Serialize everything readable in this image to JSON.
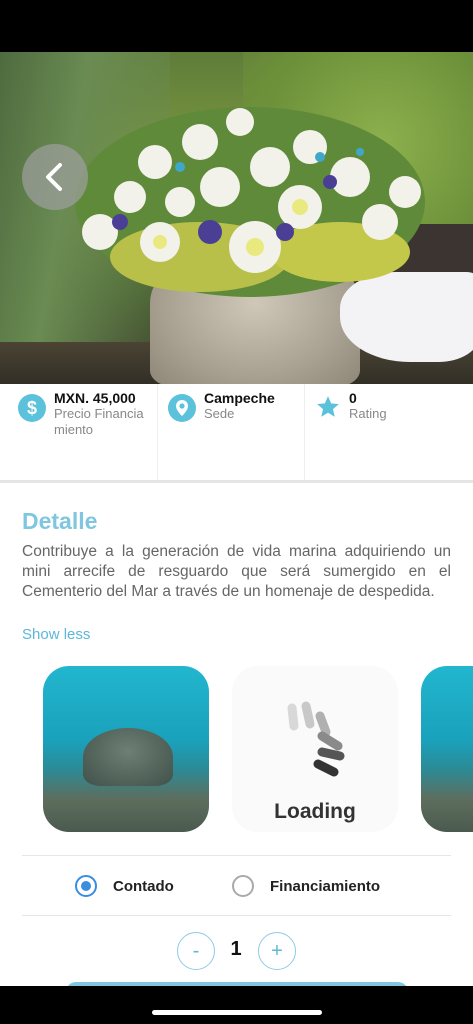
{
  "nav": {
    "back_icon": "chevron-left-icon"
  },
  "info": {
    "price": {
      "value": "MXN. 45,000",
      "label": "Precio Financiamiento",
      "icon": "dollar-icon"
    },
    "location": {
      "value": "Campeche",
      "label": "Sede",
      "icon": "location-pin-icon"
    },
    "rating": {
      "value": "0",
      "label": "Rating",
      "icon": "star-icon"
    }
  },
  "detail": {
    "title": "Detalle",
    "description": "Contribuye a la generación de vida marina adquiriendo un mini arrecife de resguardo que será sumergido en el Cementerio del Mar a través de un homenaje de despedida.",
    "toggle_label": "Show less"
  },
  "gallery": {
    "loading_label": "Loading"
  },
  "payment": {
    "options": [
      {
        "label": "Contado",
        "selected": true
      },
      {
        "label": "Financiamiento",
        "selected": false
      }
    ]
  },
  "quantity": {
    "decrement": "-",
    "value": "1",
    "increment": "+"
  },
  "colors": {
    "accent": "#7fc6e1",
    "icon_bg": "#5cc1db",
    "radio_selected": "#3a8de0"
  }
}
